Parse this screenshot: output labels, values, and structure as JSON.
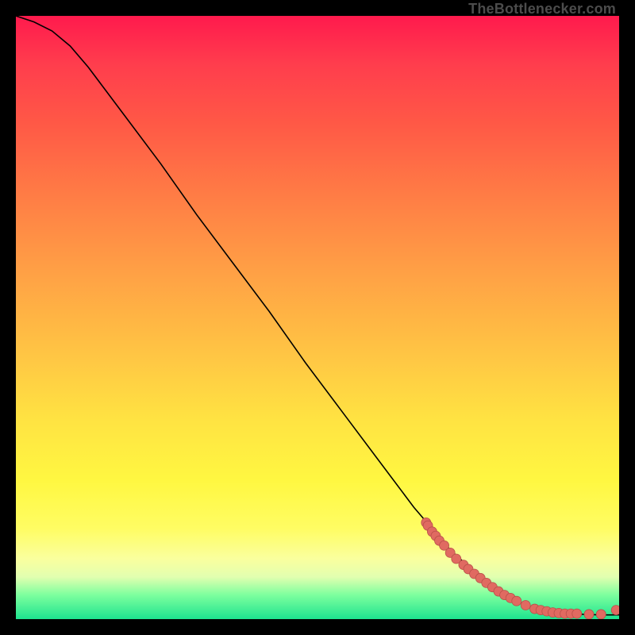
{
  "attribution": "TheBottlenecker.com",
  "colors": {
    "curve": "#000000",
    "marker": "#e06a61",
    "marker_stroke": "#b85049",
    "background_frame": "#000000"
  },
  "chart_data": {
    "type": "line",
    "title": "",
    "xlabel": "",
    "ylabel": "",
    "xlim": [
      0,
      100
    ],
    "ylim": [
      0,
      100
    ],
    "grid": false,
    "legend": false,
    "series": [
      {
        "name": "curve",
        "x": [
          0,
          3,
          6,
          9,
          12,
          15,
          18,
          24,
          30,
          36,
          42,
          48,
          54,
          60,
          66,
          72,
          78,
          82,
          85,
          88,
          91,
          94,
          97,
          100
        ],
        "y": [
          100,
          99,
          97.5,
          95,
          91.5,
          87.5,
          83.5,
          75.5,
          67,
          59,
          51,
          42.5,
          34.5,
          26.5,
          18.5,
          11.5,
          6,
          3.5,
          2.2,
          1.4,
          1.0,
          0.8,
          0.7,
          0.7
        ]
      }
    ],
    "markers": [
      {
        "x": 68.0,
        "y": 16.0
      },
      {
        "x": 68.3,
        "y": 15.5
      },
      {
        "x": 69.0,
        "y": 14.5
      },
      {
        "x": 69.6,
        "y": 13.8
      },
      {
        "x": 70.2,
        "y": 13.0
      },
      {
        "x": 71.0,
        "y": 12.2
      },
      {
        "x": 72.0,
        "y": 11.0
      },
      {
        "x": 73.0,
        "y": 10.0
      },
      {
        "x": 74.2,
        "y": 9.0
      },
      {
        "x": 75.0,
        "y": 8.3
      },
      {
        "x": 76.0,
        "y": 7.5
      },
      {
        "x": 77.0,
        "y": 6.8
      },
      {
        "x": 78.0,
        "y": 6.0
      },
      {
        "x": 79.0,
        "y": 5.3
      },
      {
        "x": 80.0,
        "y": 4.6
      },
      {
        "x": 81.0,
        "y": 4.0
      },
      {
        "x": 82.0,
        "y": 3.5
      },
      {
        "x": 83.0,
        "y": 3.0
      },
      {
        "x": 84.5,
        "y": 2.3
      },
      {
        "x": 86.0,
        "y": 1.7
      },
      {
        "x": 87.0,
        "y": 1.5
      },
      {
        "x": 88.0,
        "y": 1.3
      },
      {
        "x": 89.0,
        "y": 1.1
      },
      {
        "x": 90.0,
        "y": 1.0
      },
      {
        "x": 91.0,
        "y": 0.9
      },
      {
        "x": 92.0,
        "y": 0.9
      },
      {
        "x": 93.0,
        "y": 0.9
      },
      {
        "x": 95.0,
        "y": 0.8
      },
      {
        "x": 97.0,
        "y": 0.8
      },
      {
        "x": 99.5,
        "y": 1.5
      }
    ]
  }
}
